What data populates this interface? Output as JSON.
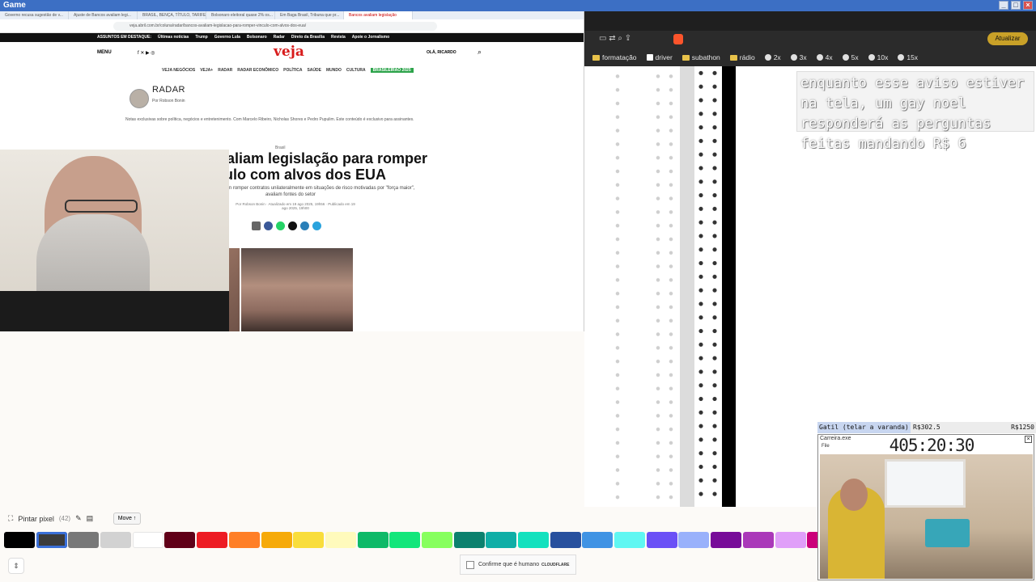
{
  "app_title": "Game",
  "left_browser": {
    "tabs": [
      "Governo recusa sugestão de v...",
      "Ajuste de Bancos avaliam legi...",
      "BRASIL, BENÇA, TÍTULO, TARIFE...",
      "Bolsonaro eleitoral quase 2% os...",
      "Em Baga Brasil, Tribuna que pr...",
      "Bancos avaliam legislação"
    ],
    "url": "veja.abril.com.br/coluna/radar/bancos-avaliam-legislacao-para-romper-vinculo-com-alvos-dos-eua/",
    "highlights_label": "ASSUNTOS EM DESTAQUE:",
    "highlights": [
      "Últimas notícias",
      "Trump",
      "Governo Lula",
      "Bolsonaro",
      "Radar",
      "Direto da Brasília",
      "Revista",
      "Apoie o Jornalismo"
    ],
    "menu": "MENU",
    "logo": "veja",
    "greeting": "OLÁ, RICARDO",
    "nav": [
      "VEJA NEGÓCIOS",
      "VEJA+",
      "RADAR",
      "RADAR ECONÔMICO",
      "POLÍTICA",
      "SAÚDE",
      "MUNDO",
      "CULTURA"
    ],
    "nav_highlight": "BRASILEIRÃO 2025",
    "column_title": "RADAR",
    "column_author": "Por Robson Bonin",
    "column_desc": "Notas exclusivas sobre política, negócios e entretenimento. Com Marcelo Ribeiro, Nicholas Shores e Pedro Pupulim. Este conteúdo é exclusivo para assinantes.",
    "kicker": "Brasil",
    "headline": "Bancos avaliam legislação para romper vínculo com alvos dos EUA",
    "subhead": "Instituições financeiras podem romper contratos unilateralmente em situações de risco motivadas por \"força maior\", avaliam fontes do setor",
    "byline": "Por Robson Bonin · Atualizado em 19 ago 2025, 19h56 · Publicado em 19 ago 2025, 19h00"
  },
  "right_browser": {
    "bookmarks": [
      "formatação",
      "driver",
      "subathon",
      "rádio",
      "2x",
      "3x",
      "4x",
      "5x",
      "10x",
      "15x"
    ],
    "update_label": "Atualizar",
    "notice": "enquanto esse aviso estiver na tela, um gay noel responderá as perguntas feitas mandando R$ 6"
  },
  "bottom_toolbar": {
    "tool": "Pintar pixel",
    "count": "(42)",
    "move": "Move ↑",
    "palette": [
      "#000000",
      "#3c3c3c",
      "#787878",
      "#d2d2d2",
      "#ffffff",
      "#600018",
      "#ed1c24",
      "#ff7f27",
      "#f6aa09",
      "#f9dd3b",
      "#fffabc",
      "#0eb968",
      "#13e67b",
      "#87ff5e",
      "#0c816e",
      "#10aea6",
      "#13e1be",
      "#28509e",
      "#4093e4",
      "#60f7f2",
      "#6b50f6",
      "#99b1fb",
      "#780c99",
      "#aa38b9",
      "#e09ff9",
      "#cb007a"
    ],
    "captcha": "Confirme que é humano",
    "captcha_brand": "CLOUDFLARE"
  },
  "stream": {
    "status_label": "Gatil (telar a varanda)",
    "status_mid": "R$302.5",
    "status_right": "R$1250",
    "window_title": "Carreira.exe",
    "file_menu": "File",
    "timer": "405:20:30"
  }
}
